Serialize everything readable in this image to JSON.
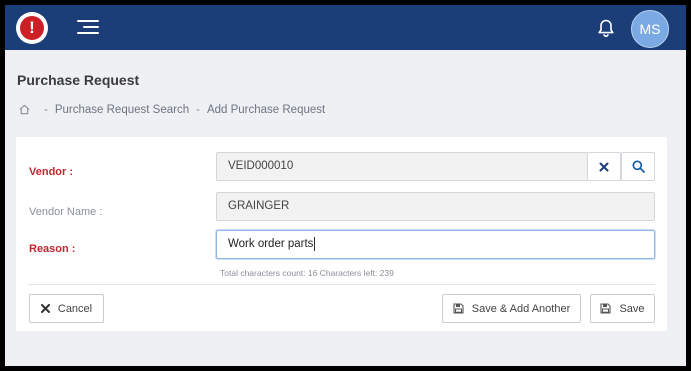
{
  "app": {
    "logo_glyph": "!",
    "user_initials": "MS",
    "colors": {
      "topbar": "#1b3e78",
      "logo_red": "#cc1f26",
      "avatar": "#7ba9e3",
      "required_label": "#c0262d"
    }
  },
  "icons": [
    "app-logo-icon",
    "hamburger-menu-icon",
    "bell-icon",
    "home-icon",
    "clear-x-icon",
    "search-icon",
    "close-x-icon",
    "save-icon"
  ],
  "page": {
    "title": "Purchase Request",
    "breadcrumb": {
      "sep": "-",
      "items": [
        "Purchase Request Search",
        "Add Purchase Request"
      ]
    }
  },
  "form": {
    "vendor": {
      "label": "Vendor :",
      "value": "VEID000010"
    },
    "vendor_name": {
      "label": "Vendor Name :",
      "value": "GRAINGER"
    },
    "reason": {
      "label": "Reason :",
      "value": "Work order parts",
      "help": "Total characters count: 16 Characters left: 239"
    }
  },
  "actions": {
    "cancel": "Cancel",
    "save_add_another": "Save & Add Another",
    "save": "Save"
  }
}
